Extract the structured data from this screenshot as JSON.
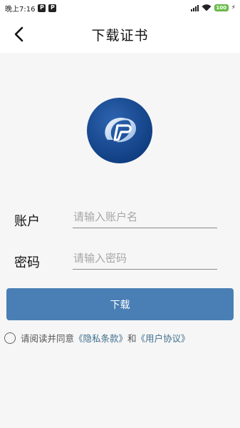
{
  "status_bar": {
    "time": "晚上7:16",
    "app_icons": [
      "P",
      "P"
    ],
    "battery": "100",
    "icons": [
      "signal-icon",
      "wifi-icon",
      "battery-icon",
      "charging-icon"
    ]
  },
  "header": {
    "title": "下载证书",
    "back_icon": "chevron-left-icon"
  },
  "form": {
    "account_label": "账户",
    "account_placeholder": "请输入账户名",
    "password_label": "密码",
    "password_placeholder": "请输入密码"
  },
  "download_button": "下载",
  "agreement": {
    "prefix": "请阅读并同意",
    "privacy_link": "《隐私条款》",
    "and": "和",
    "user_agreement_link": "《用户协议》"
  },
  "colors": {
    "accent": "#4a7fb5",
    "link": "#3f6e8f",
    "logo_blue": "#1a4a8c"
  }
}
